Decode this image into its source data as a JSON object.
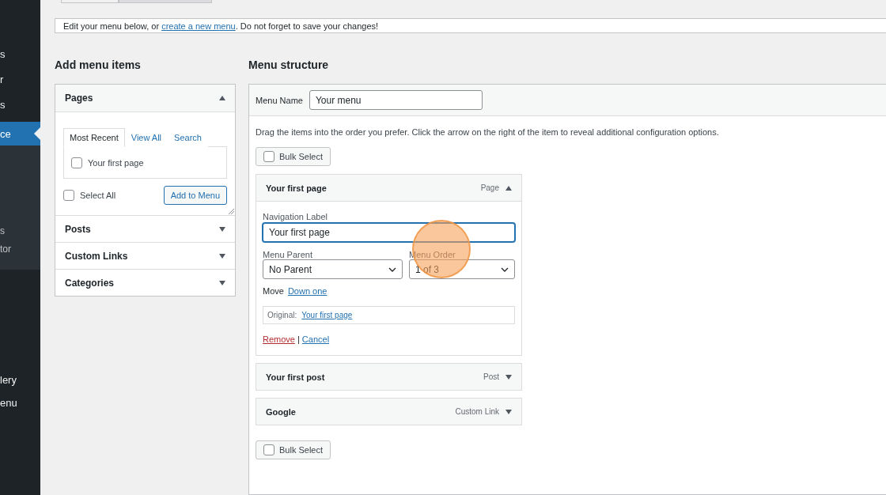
{
  "sidebar": {
    "groups": [
      {
        "kind": "main",
        "items": [
          {
            "label": "s",
            "selected": false
          },
          {
            "label": "r",
            "selected": false
          },
          {
            "label": "s",
            "selected": false
          },
          {
            "label": "ce",
            "selected": true
          }
        ]
      },
      {
        "kind": "sub",
        "items": [
          {
            "label": "s",
            "selected": false
          },
          {
            "label": "tor",
            "selected": false
          }
        ]
      },
      {
        "kind": "tail",
        "items": [
          {
            "label": "lery",
            "selected": false
          },
          {
            "label": "enu",
            "selected": false
          }
        ]
      }
    ]
  },
  "tabs": [
    {
      "selected": true
    },
    {
      "selected": false
    }
  ],
  "notice": {
    "before": "Edit your menu below, or ",
    "link": "create a new menu",
    "after": ". Do not forget to save your changes!"
  },
  "add_menu_items": {
    "heading": "Add menu items",
    "sections": [
      {
        "title": "Pages",
        "expanded": true,
        "tabs": [
          {
            "label": "Most Recent",
            "selected": true
          },
          {
            "label": "View All",
            "selected": false
          },
          {
            "label": "Search",
            "selected": false
          }
        ],
        "items": [
          {
            "label": "Your first page",
            "checked": false
          }
        ],
        "select_all": {
          "label": "Select All",
          "checked": false
        },
        "button": "Add to Menu"
      },
      {
        "title": "Posts",
        "expanded": false
      },
      {
        "title": "Custom Links",
        "expanded": false
      },
      {
        "title": "Categories",
        "expanded": false
      }
    ]
  },
  "menu_structure": {
    "heading": "Menu structure",
    "menu_name_label": "Menu Name",
    "menu_name": "Your menu",
    "instructions": "Drag the items into the order you prefer. Click the arrow on the right of the item to reveal additional configuration options.",
    "bulk_select_top": {
      "label": "Bulk Select",
      "checked": false
    },
    "items": [
      {
        "title": "Your first page",
        "type": "Page",
        "expanded": true,
        "navigation_label": "Navigation Label",
        "navigation_value": "Your first page",
        "parent_label": "Menu Parent",
        "parent_value": "No Parent",
        "order_label": "Menu Order",
        "order_value": "1 of 3",
        "move_label": "Move",
        "move_link": "Down one",
        "original_label": "Original:",
        "original_link": "Your first page",
        "remove": "Remove",
        "separator": "|",
        "cancel": "Cancel"
      },
      {
        "title": "Your first post",
        "type": "Post",
        "expanded": false
      },
      {
        "title": "Google",
        "type": "Custom Link",
        "expanded": false
      }
    ],
    "bulk_select_bottom": {
      "label": "Bulk Select",
      "checked": false
    }
  }
}
